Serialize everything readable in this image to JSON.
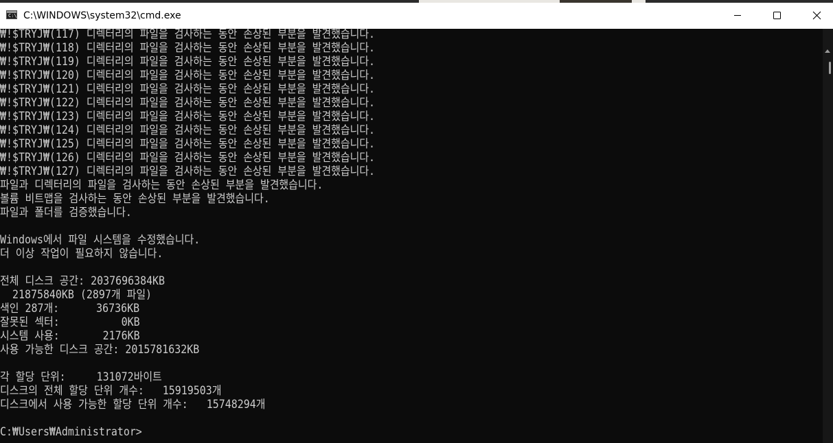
{
  "window": {
    "title": "C:\\WINDOWS\\system32\\cmd.exe",
    "icon_glyph": "C:\\"
  },
  "icons": {
    "app": "command-prompt-icon",
    "minimize": "minimize-icon",
    "maximize": "maximize-icon",
    "close": "close-icon",
    "scroll_up": "scroll-up-arrow-icon"
  },
  "terminal": {
    "lines": [
      "₩!$TRYJ₩(117) 디렉터리의 파일을 검사하는 동안 손상된 부분을 발견했습니다.",
      "₩!$TRYJ₩(118) 디렉터리의 파일을 검사하는 동안 손상된 부분을 발견했습니다.",
      "₩!$TRYJ₩(119) 디렉터리의 파일을 검사하는 동안 손상된 부분을 발견했습니다.",
      "₩!$TRYJ₩(120) 디렉터리의 파일을 검사하는 동안 손상된 부분을 발견했습니다.",
      "₩!$TRYJ₩(121) 디렉터리의 파일을 검사하는 동안 손상된 부분을 발견했습니다.",
      "₩!$TRYJ₩(122) 디렉터리의 파일을 검사하는 동안 손상된 부분을 발견했습니다.",
      "₩!$TRYJ₩(123) 디렉터리의 파일을 검사하는 동안 손상된 부분을 발견했습니다.",
      "₩!$TRYJ₩(124) 디렉터리의 파일을 검사하는 동안 손상된 부분을 발견했습니다.",
      "₩!$TRYJ₩(125) 디렉터리의 파일을 검사하는 동안 손상된 부분을 발견했습니다.",
      "₩!$TRYJ₩(126) 디렉터리의 파일을 검사하는 동안 손상된 부분을 발견했습니다.",
      "₩!$TRYJ₩(127) 디렉터리의 파일을 검사하는 동안 손상된 부분을 발견했습니다.",
      "파일과 디렉터리의 파일을 검사하는 동안 손상된 부분을 발견했습니다.",
      "볼륨 비트맵을 검사하는 동안 손상된 부분을 발견했습니다.",
      "파일과 폴더를 검증했습니다.",
      "",
      "Windows에서 파일 시스템을 수정했습니다.",
      "더 이상 작업이 필요하지 않습니다.",
      "",
      "전체 디스크 공간: 2037696384KB",
      "  21875840KB (2897개 파일)",
      "색인 287개:      36736KB",
      "잘못된 섹터:          0KB",
      "시스템 사용:       2176KB",
      "사용 가능한 디스크 공간: 2015781632KB",
      "",
      "각 할당 단위:     131072바이트",
      "디스크의 전체 할당 단위 개수:   15919503개",
      "디스크에서 사용 가능한 할당 단위 개수:   15748294개",
      "",
      "C:₩Users₩Administrator>"
    ]
  },
  "colors": {
    "terminal_bg": "#0c0c0c",
    "terminal_fg": "#cccccc",
    "titlebar_bg": "#ffffff"
  }
}
